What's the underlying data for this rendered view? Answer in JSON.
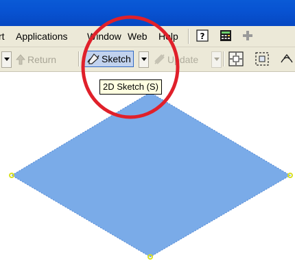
{
  "menu": {
    "items": [
      "rt",
      "Applications",
      "Window",
      "Web",
      "Help"
    ]
  },
  "toolbar": {
    "return_label": "Return",
    "sketch_label": "Sketch",
    "update_label": "Update"
  },
  "tooltip": {
    "text": "2D Sketch (S)"
  },
  "colors": {
    "title_bar": "#0853d2",
    "shape_fill": "#7aabe8",
    "highlight_circle": "#e0202a",
    "tooltip_bg": "#ffffe1"
  },
  "icons": [
    "help-icon",
    "calculator-icon",
    "add-icon",
    "return-arrow-icon",
    "sketch-pencil-icon",
    "update-icon",
    "zoom-all-icon",
    "zoom-window-icon",
    "orbit-icon"
  ]
}
